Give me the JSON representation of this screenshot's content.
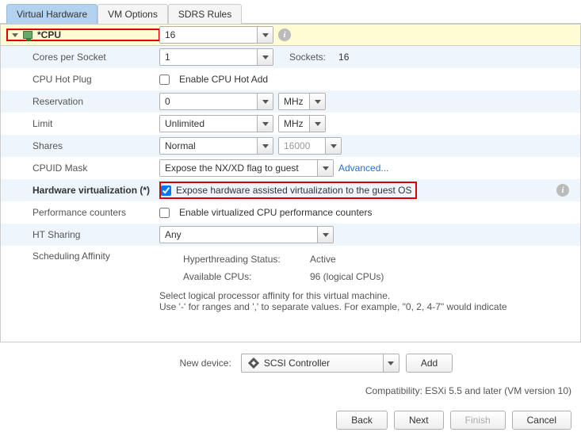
{
  "tabs": [
    "Virtual Hardware",
    "VM Options",
    "SDRS Rules"
  ],
  "cpu": {
    "label": "*CPU",
    "value": "16",
    "cores_per_socket": {
      "label": "Cores per Socket",
      "value": "1",
      "sockets_label": "Sockets:",
      "sockets_value": "16"
    },
    "hot_plug": {
      "label": "CPU Hot Plug",
      "checkbox": "Enable CPU Hot Add"
    },
    "reservation": {
      "label": "Reservation",
      "value": "0",
      "unit": "MHz"
    },
    "limit": {
      "label": "Limit",
      "value": "Unlimited",
      "unit": "MHz"
    },
    "shares": {
      "label": "Shares",
      "value": "Normal",
      "input": "16000"
    },
    "cpuid_mask": {
      "label": "CPUID Mask",
      "value": "Expose the NX/XD flag to guest",
      "link": "Advanced..."
    },
    "hardware_virt": {
      "label": "Hardware virtualization (*)",
      "checkbox": "Expose hardware assisted virtualization to the guest OS"
    },
    "perf_counters": {
      "label": "Performance counters",
      "checkbox": "Enable virtualized CPU performance counters"
    },
    "ht_sharing": {
      "label": "HT Sharing",
      "value": "Any"
    },
    "sched_affinity": {
      "label": "Scheduling Affinity",
      "ht_status_label": "Hyperthreading Status:",
      "ht_status_value": "Active",
      "avail_label": "Available CPUs:",
      "avail_value": "96 (logical CPUs)",
      "help1": "Select logical processor affinity for this virtual machine.",
      "help2": "Use '-' for ranges and ',' to separate values. For example,  \"0, 2, 4-7\" would indicate"
    }
  },
  "new_device": {
    "label": "New device:",
    "value": "SCSI Controller",
    "add": "Add"
  },
  "compat": "Compatibility: ESXi 5.5 and later (VM version 10)",
  "buttons": {
    "back": "Back",
    "next": "Next",
    "finish": "Finish",
    "cancel": "Cancel"
  }
}
